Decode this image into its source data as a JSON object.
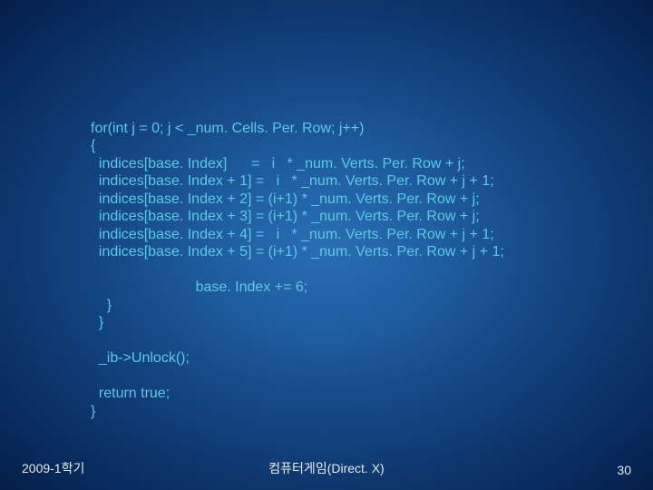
{
  "code": {
    "l0": "for(int j = 0; j < _num. Cells. Per. Row; j++)",
    "l1": "{",
    "l2": "  indices[base. Index]      =   i   * _num. Verts. Per. Row + j;",
    "l3": "  indices[base. Index + 1] =   i   * _num. Verts. Per. Row + j + 1;",
    "l4": "  indices[base. Index + 2] = (i+1) * _num. Verts. Per. Row + j;",
    "l5": "  indices[base. Index + 3] = (i+1) * _num. Verts. Per. Row + j;",
    "l6": "  indices[base. Index + 4] =   i   * _num. Verts. Per. Row + j + 1;",
    "l7": "  indices[base. Index + 5] = (i+1) * _num. Verts. Per. Row + j + 1;",
    "l8": "",
    "l9": "                          base. Index += 6;",
    "l10": "    }",
    "l11": "  }",
    "l12": "",
    "l13": "  _ib->Unlock();",
    "l14": "",
    "l15": "  return true;",
    "l16": "}"
  },
  "footer": {
    "left": "2009-1학기",
    "center": "컴퓨터게임(Direct. X)",
    "right": "30"
  }
}
